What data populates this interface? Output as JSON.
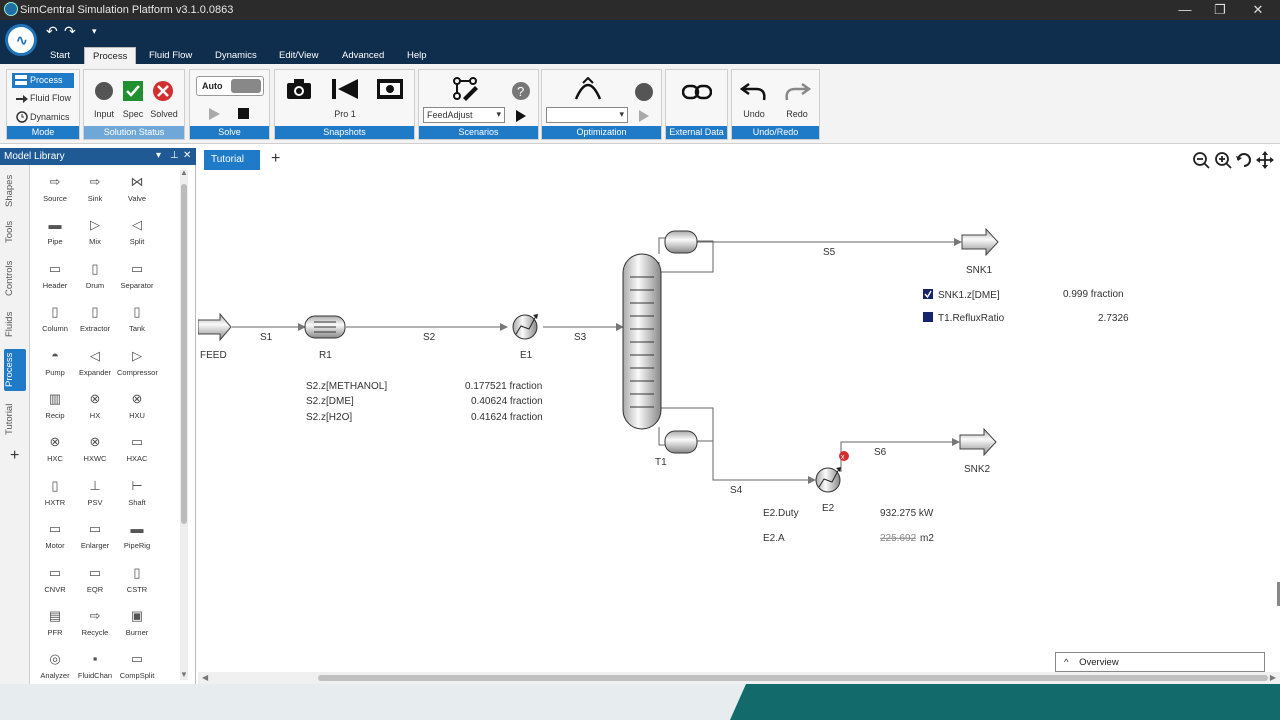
{
  "window": {
    "title": "SimCentral Simulation Platform v3.1.0.0863",
    "min": "—",
    "restore": "❐",
    "close": "✕"
  },
  "quick_access": {
    "undo": "↶",
    "redo": "↷",
    "more": "▾"
  },
  "tabs": [
    "Start",
    "Process",
    "Fluid Flow",
    "Dynamics",
    "Edit/View",
    "Advanced",
    "Help"
  ],
  "ribbon": {
    "mode": {
      "label": "Mode",
      "process": "Process",
      "fluid_flow": "Fluid Flow",
      "dynamics": "Dynamics"
    },
    "solution_status": {
      "label": "Solution Status",
      "input": "Input",
      "spec": "Spec",
      "solved": "Solved"
    },
    "solve": {
      "label": "Solve",
      "auto": "Auto"
    },
    "snapshots": {
      "label": "Snapshots",
      "name": "Pro 1"
    },
    "scenarios": {
      "label": "Scenarios",
      "selected": "FeedAdjust"
    },
    "optimization": {
      "label": "Optimization",
      "selected": ""
    },
    "external_data": {
      "label": "External Data"
    },
    "undo_redo": {
      "label": "Undo/Redo",
      "undo": "Undo",
      "redo": "Redo"
    }
  },
  "model_library": {
    "title": "Model Library",
    "vertical_tabs": [
      "Shapes",
      "Tools",
      "Controls",
      "Fluids",
      "Process",
      "Tutorial"
    ],
    "add": "+",
    "items": [
      {
        "label": "Source",
        "icon": "⇨"
      },
      {
        "label": "Sink",
        "icon": "⇨"
      },
      {
        "label": "Valve",
        "icon": "⋈"
      },
      {
        "label": "Pipe",
        "icon": "▬"
      },
      {
        "label": "Mix",
        "icon": "▷"
      },
      {
        "label": "Split",
        "icon": "◁"
      },
      {
        "label": "Header",
        "icon": "▭"
      },
      {
        "label": "Drum",
        "icon": "▯"
      },
      {
        "label": "Separator",
        "icon": "▭"
      },
      {
        "label": "Column",
        "icon": "▯"
      },
      {
        "label": "Extractor",
        "icon": "▯"
      },
      {
        "label": "Tank",
        "icon": "▯"
      },
      {
        "label": "Pump",
        "icon": "◓"
      },
      {
        "label": "Expander",
        "icon": "◁"
      },
      {
        "label": "Compressor",
        "icon": "▷"
      },
      {
        "label": "Recip",
        "icon": "▥"
      },
      {
        "label": "HX",
        "icon": "⊗"
      },
      {
        "label": "HXU",
        "icon": "⊗"
      },
      {
        "label": "HXC",
        "icon": "⊗"
      },
      {
        "label": "HXWC",
        "icon": "⊗"
      },
      {
        "label": "HXAC",
        "icon": "▭"
      },
      {
        "label": "HXTR",
        "icon": "▯"
      },
      {
        "label": "PSV",
        "icon": "⊥"
      },
      {
        "label": "Shaft",
        "icon": "⊢"
      },
      {
        "label": "Motor",
        "icon": "▭"
      },
      {
        "label": "Enlarger",
        "icon": "▭"
      },
      {
        "label": "PipeRig",
        "icon": "▬"
      },
      {
        "label": "CNVR",
        "icon": "▭"
      },
      {
        "label": "EQR",
        "icon": "▭"
      },
      {
        "label": "CSTR",
        "icon": "▯"
      },
      {
        "label": "PFR",
        "icon": "▤"
      },
      {
        "label": "Recycle",
        "icon": "⇨"
      },
      {
        "label": "Burner",
        "icon": "▣"
      },
      {
        "label": "Analyzer",
        "icon": "◎"
      },
      {
        "label": "FluidChan",
        "icon": "▪"
      },
      {
        "label": "CompSplit",
        "icon": "▭"
      }
    ]
  },
  "document_tab": {
    "label": "Tutorial",
    "add": "+"
  },
  "flowsheet": {
    "streams": {
      "s1": "S1",
      "s2": "S2",
      "s3": "S3",
      "s4": "S4",
      "s5": "S5",
      "s6": "S6"
    },
    "units": {
      "feed": "FEED",
      "r1": "R1",
      "e1": "E1",
      "t1": "T1",
      "e2": "E2",
      "snk1": "SNK1",
      "snk2": "SNK2"
    },
    "s2_table": [
      {
        "name": "S2.z[METHANOL]",
        "value": "0.177521 fraction"
      },
      {
        "name": "S2.z[DME]",
        "value": "0.40624 fraction"
      },
      {
        "name": "S2.z[H2O]",
        "value": "0.41624 fraction"
      }
    ],
    "snk1_table": [
      {
        "name": "SNK1.z[DME]",
        "value": "0.999 fraction"
      },
      {
        "name": "T1.RefluxRatio",
        "value": "2.7326"
      }
    ],
    "e2_table": [
      {
        "name": "E2.Duty",
        "value": "932.275 kW"
      },
      {
        "name": "E2.A",
        "value": "225.692",
        "unit": "m2"
      }
    ],
    "error_marker": "x"
  },
  "overview": {
    "label": "Overview",
    "chevron": "^"
  },
  "colors": {
    "accent": "#1f7ac7",
    "nav": "#0f2d4d",
    "error": "#d32f2f",
    "ok": "#1f8f2f",
    "teal": "#126b6a"
  }
}
